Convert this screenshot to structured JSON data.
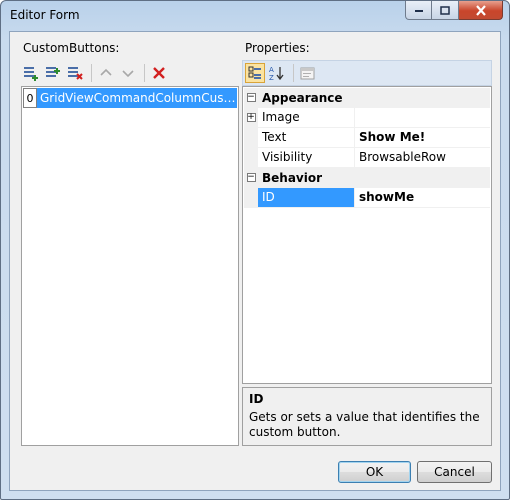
{
  "window": {
    "title": "Editor Form"
  },
  "left": {
    "label": "CustomButtons:",
    "items": [
      {
        "index": "0",
        "text": "GridViewCommandColumnCustomButton"
      }
    ]
  },
  "right": {
    "label": "Properties:",
    "categories": [
      {
        "name": "Appearance",
        "expanded": true,
        "props": [
          {
            "name": "Image",
            "value": "",
            "expandable": true,
            "bold": false
          },
          {
            "name": "Text",
            "value": "Show Me!",
            "bold": true
          },
          {
            "name": "Visibility",
            "value": "BrowsableRow",
            "bold": false
          }
        ]
      },
      {
        "name": "Behavior",
        "expanded": true,
        "props": [
          {
            "name": "ID",
            "value": "showMe",
            "bold": true,
            "selected": true
          }
        ]
      }
    ],
    "help": {
      "title": "ID",
      "description": "Gets or sets a value that identifies the custom button."
    }
  },
  "buttons": {
    "ok": "OK",
    "cancel": "Cancel"
  },
  "colors": {
    "selection": "#3399ff",
    "delete_icon": "#d22020",
    "titlebar": "#b9d1ea"
  }
}
